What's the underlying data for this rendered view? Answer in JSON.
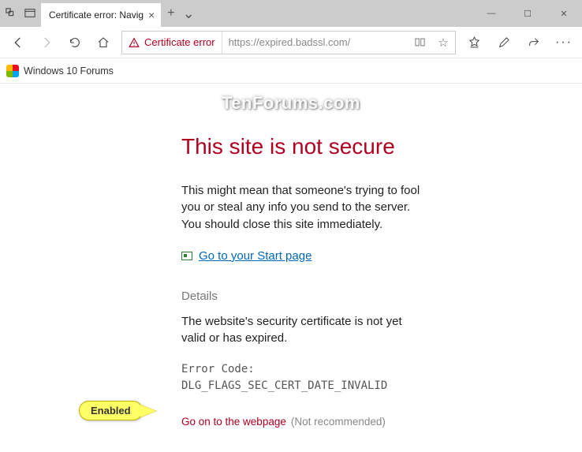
{
  "titlebar": {
    "tab_title": "Certificate error: Navig",
    "min": "—",
    "max": "☐",
    "close": "✕"
  },
  "toolbar": {
    "cert_label": "Certificate error",
    "url": "https://expired.badssl.com/"
  },
  "bookmarks": {
    "item1": "Windows 10 Forums"
  },
  "page": {
    "title": "This site is not secure",
    "body1": "This might mean that someone's trying to fool you or steal any info you send to the server. You should close this site immediately.",
    "start_link": "Go to your Start page",
    "details_heading": "Details",
    "details_body": "The website's security certificate is not yet valid or has expired.",
    "error_label": "Error Code:",
    "error_code": "DLG_FLAGS_SEC_CERT_DATE_INVALID",
    "go_on": "Go on to the webpage",
    "not_rec": "(Not recommended)"
  },
  "annotation": {
    "label": "Enabled"
  },
  "watermark": "TenForums.com"
}
